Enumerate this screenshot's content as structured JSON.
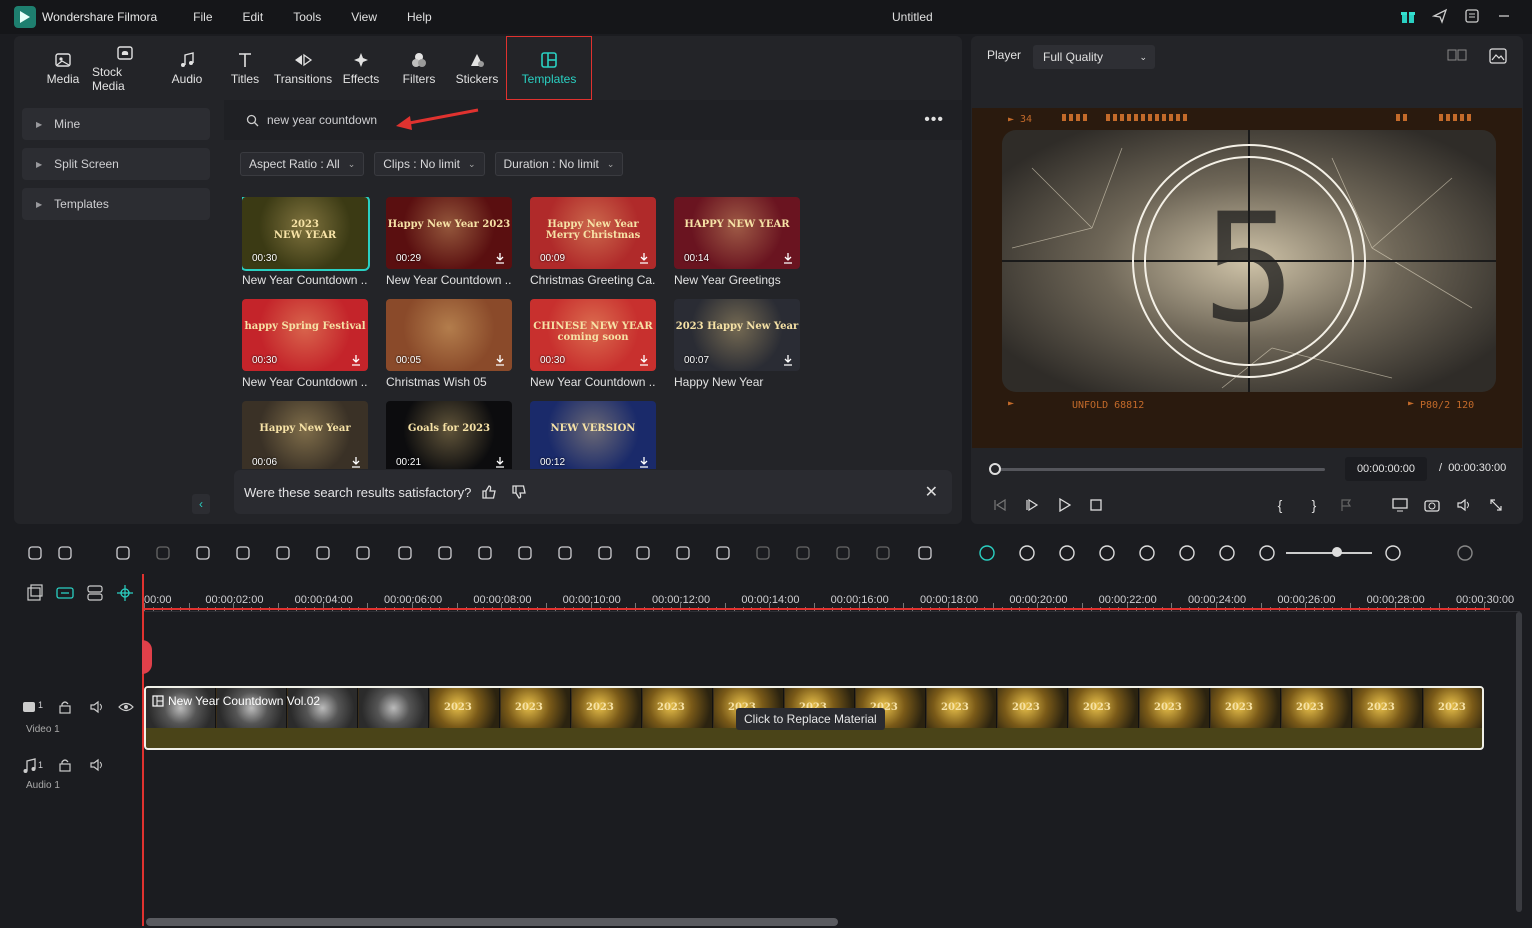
{
  "app": {
    "name": "Wondershare Filmora",
    "doc_title": "Untitled"
  },
  "menu": [
    "File",
    "Edit",
    "Tools",
    "View",
    "Help"
  ],
  "tabs": [
    {
      "label": "Media",
      "icon": "media-icon"
    },
    {
      "label": "Stock Media",
      "icon": "cloud-icon"
    },
    {
      "label": "Audio",
      "icon": "music-note-icon"
    },
    {
      "label": "Titles",
      "icon": "text-icon"
    },
    {
      "label": "Transitions",
      "icon": "transition-icon"
    },
    {
      "label": "Effects",
      "icon": "sparkle-icon"
    },
    {
      "label": "Filters",
      "icon": "filters-icon"
    },
    {
      "label": "Stickers",
      "icon": "sticker-icon"
    },
    {
      "label": "Templates",
      "icon": "templates-icon",
      "active": true
    }
  ],
  "sidebar": {
    "items": [
      {
        "label": "Mine"
      },
      {
        "label": "Split Screen"
      },
      {
        "label": "Templates"
      }
    ]
  },
  "search": {
    "value": "new year countdown"
  },
  "filters": [
    {
      "label": "Aspect Ratio : All"
    },
    {
      "label": "Clips : No limit"
    },
    {
      "label": "Duration : No limit"
    }
  ],
  "templates": [
    {
      "title": "New Year Countdown ...",
      "duration": "00:30",
      "thumb_text": "2023\nNEW YEAR",
      "bg": "#3b3a14",
      "selected": true
    },
    {
      "title": "New Year Countdown ...",
      "duration": "00:29",
      "thumb_text": "Happy New Year 2023",
      "bg": "#5a0f10"
    },
    {
      "title": "Christmas Greeting Ca...",
      "duration": "00:09",
      "thumb_text": "Happy New Year Merry Christmas",
      "bg": "#b02a2a"
    },
    {
      "title": "New Year Greetings",
      "duration": "00:14",
      "thumb_text": "HAPPY NEW YEAR",
      "bg": "#6a1420"
    },
    {
      "title": "New Year Countdown ...",
      "duration": "00:30",
      "thumb_text": "happy Spring Festival",
      "bg": "#c4242a"
    },
    {
      "title": "Christmas Wish 05",
      "duration": "00:05",
      "thumb_text": "",
      "bg": "#8a4a2a"
    },
    {
      "title": "New Year Countdown ...",
      "duration": "00:30",
      "thumb_text": "CHINESE NEW YEAR coming soon",
      "bg": "#c8302e"
    },
    {
      "title": "Happy New Year",
      "duration": "00:07",
      "thumb_text": "2023 Happy New Year",
      "bg": "#2a2c34"
    },
    {
      "title": "",
      "duration": "00:06",
      "thumb_text": "Happy New Year",
      "bg": "#3a3126"
    },
    {
      "title": "",
      "duration": "00:21",
      "thumb_text": "Goals for 2023",
      "bg": "#0c0c0e"
    },
    {
      "title": "",
      "duration": "00:12",
      "thumb_text": "NEW VERSION",
      "bg": "#1a2a6a"
    }
  ],
  "feedback": {
    "question": "Were these search results satisfactory?"
  },
  "player": {
    "label": "Player",
    "quality": "Full Quality",
    "current_time": "00:00:00:00",
    "separator": "/",
    "total_time": "00:00:30:00",
    "countdown_number": "5",
    "film_top_text": "► 34",
    "film_bottom_left": "UNFOLD 68812",
    "film_bottom_right": "P80/2 120",
    "progress": 0
  },
  "timeline": {
    "ruler": [
      "00:00",
      "00:00:02:00",
      "00:00:04:00",
      "00:00:06:00",
      "00:00:08:00",
      "00:00:10:00",
      "00:00:12:00",
      "00:00:14:00",
      "00:00:16:00",
      "00:00:18:00",
      "00:00:20:00",
      "00:00:22:00",
      "00:00:24:00",
      "00:00:26:00",
      "00:00:28:00",
      "00:00:30:00"
    ],
    "tracks": [
      {
        "label": "Video 1",
        "num": "1"
      },
      {
        "label": "Audio 1",
        "num": "1"
      }
    ],
    "clip": {
      "label": "New Year Countdown Vol.02",
      "tooltip": "Click to Replace Material"
    },
    "thumb_year": "2023"
  },
  "colors": {
    "accent": "#2ad0c2",
    "highlight": "#e0322f",
    "panel": "#232428"
  }
}
